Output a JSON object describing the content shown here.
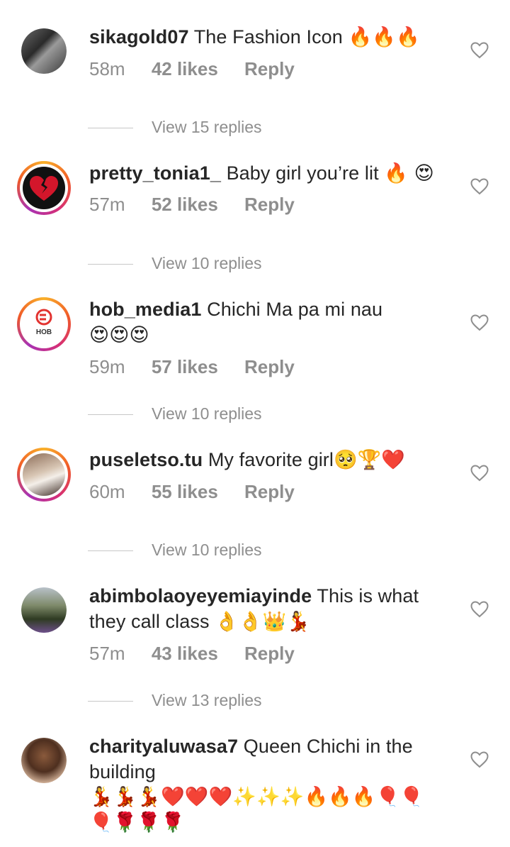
{
  "comments": [
    {
      "username": "sikagold07",
      "text": "The Fashion Icon",
      "emoji": "🔥🔥🔥",
      "time": "58m",
      "likes": "42 likes",
      "reply": "Reply",
      "view_replies": "View 15 replies"
    },
    {
      "username": "pretty_tonia1_",
      "text": "Baby girl you’re lit",
      "emoji": "🔥 😍",
      "time": "57m",
      "likes": "52 likes",
      "reply": "Reply",
      "view_replies": "View 10 replies"
    },
    {
      "username": "hob_media1",
      "text": "Chichi Ma pa mi nau",
      "emoji": "😍😍😍",
      "time": "59m",
      "likes": "57 likes",
      "reply": "Reply",
      "view_replies": "View 10 replies",
      "avatar_text": "HOB"
    },
    {
      "username": "puseletso.tu",
      "text": "My favorite girl",
      "emoji": "🥺🏆❤️",
      "time": "60m",
      "likes": "55 likes",
      "reply": "Reply",
      "view_replies": "View 10 replies"
    },
    {
      "username": "abimbolaoyeyemiayinde",
      "text": "This is what they call class",
      "emoji": "👌👌👑💃",
      "time": "57m",
      "likes": "43 likes",
      "reply": "Reply",
      "view_replies": "View 13 replies"
    },
    {
      "username": "charityaluwasa7",
      "text": "Queen Chichi in the building",
      "emoji": "💃💃💃❤️❤️❤️✨✨✨🔥🔥🔥🎈🎈🎈🌹🌹🌹"
    }
  ],
  "colors": {
    "text": "#262626",
    "secondary": "#8e8e8e",
    "divider": "#c7c7c7",
    "heart_outline": "#8e8e8e"
  },
  "icons": {
    "like": "heart-outline-icon"
  }
}
